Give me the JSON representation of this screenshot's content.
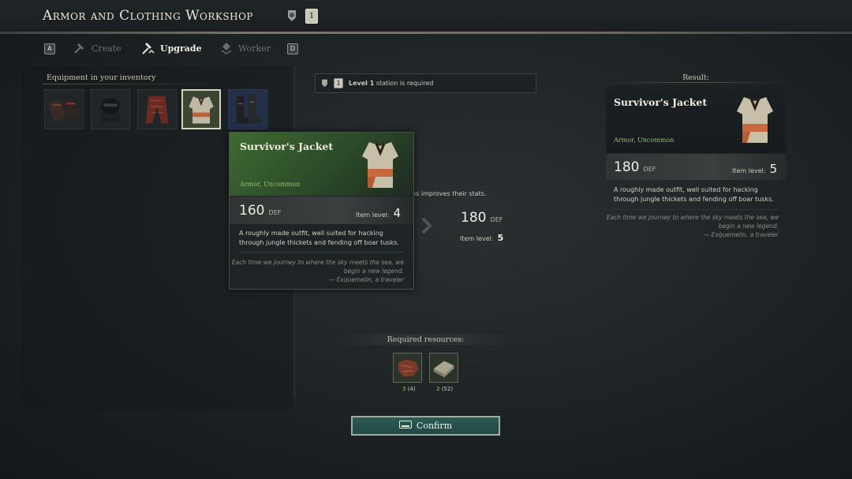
{
  "header": {
    "title": "Armor and Clothing Workshop",
    "station_level": "1"
  },
  "tabs": {
    "prev_key": "A",
    "next_key": "D",
    "items": [
      {
        "label": "Create",
        "icon": "hammer-icon",
        "state": "inactive"
      },
      {
        "label": "Upgrade",
        "icon": "upgrade-icon",
        "state": "active"
      },
      {
        "label": "Worker",
        "icon": "worker-icon",
        "state": "inactive"
      }
    ]
  },
  "inventory": {
    "label": "Equipment in your inventory",
    "items": [
      {
        "name": "bracers",
        "selected": false
      },
      {
        "name": "mask",
        "selected": false
      },
      {
        "name": "trousers",
        "selected": false
      },
      {
        "name": "jacket",
        "selected": true
      },
      {
        "name": "boots",
        "selected": false
      }
    ]
  },
  "requirement": {
    "level_bold": "Level 1",
    "text": " station is required"
  },
  "upgrade_note": "ns improves their stats.",
  "tooltip": {
    "name": "Survivor's Jacket",
    "rarity": "Armor, Uncommon",
    "def": "160",
    "def_unit": "DEF",
    "item_level_label": "Item level:",
    "item_level": "4",
    "desc_line1": "A roughly made outfit, well suited for hacking",
    "desc_line2": "through jungle thickets and fending off boar tusks.",
    "quote_line1": "Each time we journey to where the sky meets the sea, we",
    "quote_line2": "begin a new legend.",
    "quote_line3": "— Exquemelin, a traveler"
  },
  "compare": {
    "def": "180",
    "def_unit": "DEF",
    "item_level_label": "Item level:",
    "item_level": "5"
  },
  "result": {
    "label": "Result:",
    "name": "Survivor's Jacket",
    "rarity": "Armor, Uncommon",
    "def": "180",
    "def_unit": "DEF",
    "item_level_label": "Item level:",
    "item_level": "5",
    "desc_line1": "A roughly made outfit, well suited for hacking",
    "desc_line2": "through jungle thickets and fending off boar tusks.",
    "quote_line1": "Each time we journey to where the sky meets the sea, we",
    "quote_line2": "begin a new legend.",
    "quote_line3": "— Exquemelin, a traveler"
  },
  "resources": {
    "label": "Required resources:",
    "items": [
      {
        "name": "leather",
        "need": "3",
        "have": "(4)"
      },
      {
        "name": "cloth",
        "need": "2",
        "have": "(52)"
      }
    ]
  },
  "confirm": {
    "label": "Confirm",
    "icon": "keyboard-icon"
  },
  "colors": {
    "accent": "#8fc06a",
    "confirm_bg": "#1f4a43",
    "tooltip_green": "#2f5a2e"
  }
}
